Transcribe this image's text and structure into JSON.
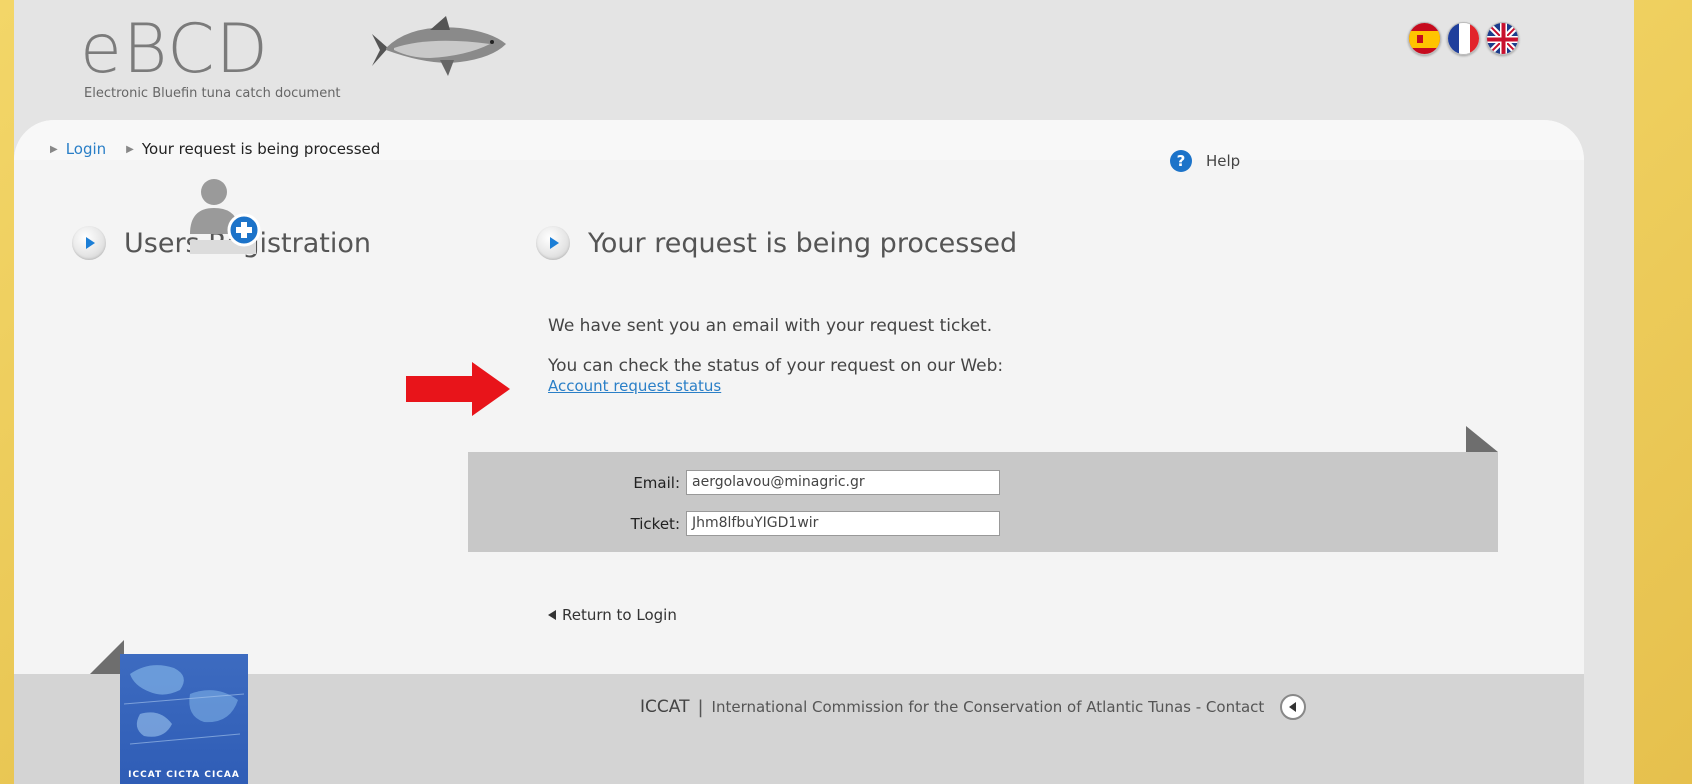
{
  "header": {
    "logo_text": "eBCD",
    "logo_subtitle": "Electronic Bluefin tuna catch document",
    "flags": [
      "spain-flag-icon",
      "france-flag-icon",
      "uk-flag-icon"
    ]
  },
  "breadcrumb": {
    "items": [
      "Login",
      "Your request is being processed"
    ]
  },
  "help": {
    "label": "Help",
    "icon": "help-icon"
  },
  "sidebar": {
    "title": "Users Registration",
    "icon": "add-user-icon"
  },
  "main": {
    "title": "Your request is being processed",
    "message1": "We have sent you an email with your request ticket.",
    "message2": "You can check the status of your request on our Web:",
    "status_link": "Account request status"
  },
  "form": {
    "email_label": "Email:",
    "email_value": "aergolavou@minagric.gr",
    "ticket_label": "Ticket:",
    "ticket_value": "Jhm8lfbuYIGD1wir"
  },
  "return_link": "Return to Login",
  "footer": {
    "org_short": "ICCAT",
    "separator": "|",
    "org_long": "International Commission for the Conservation of Atlantic Tunas - Contact",
    "logo_caption": "ICCAT  CICTA  CICAA"
  },
  "colors": {
    "accent": "#2a7fc7",
    "highlight_arrow": "#e8141a",
    "background": "#e8c552"
  }
}
